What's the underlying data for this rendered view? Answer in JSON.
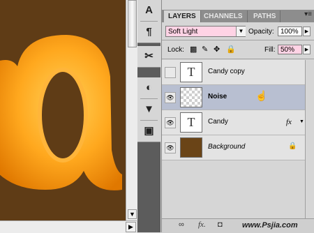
{
  "tabs": {
    "layers": "LAYERS",
    "channels": "CHANNELS",
    "paths": "PATHS"
  },
  "blend_mode": "Soft Light",
  "opacity": {
    "label": "Opacity:",
    "value": "100%"
  },
  "lock": {
    "label": "Lock:"
  },
  "fill": {
    "label": "Fill:",
    "value": "50%"
  },
  "layers": [
    {
      "name": "Candy copy",
      "thumb": "T",
      "visible": false,
      "selected": false,
      "style": "normal"
    },
    {
      "name": "Noise",
      "thumb": "",
      "visible": true,
      "selected": true,
      "style": "bold"
    },
    {
      "name": "Candy",
      "thumb": "T",
      "visible": true,
      "selected": false,
      "style": "normal",
      "fx": "fx"
    },
    {
      "name": "Background",
      "thumb": "",
      "visible": true,
      "selected": false,
      "style": "italic",
      "locked": true
    }
  ],
  "tools": {
    "type_glyph": "A",
    "paragraph_glyph": "¶",
    "tool3": "✂",
    "tool4": "◐",
    "tool5": "▼",
    "tool6": "▣"
  },
  "bottom_bar": {
    "link": "∞",
    "fx": "fx.",
    "mask": "◘",
    "adj": "◑.",
    "folder": "▭",
    "new": "▢",
    "trash": "🗑"
  },
  "watermark": "www.Psjia.com",
  "colors": {
    "canvas_bg": "#5f3c16",
    "letter_fill": "#ffa21a",
    "selected_row": "#b8bfd1",
    "blend_field": "#ffd3e5"
  }
}
